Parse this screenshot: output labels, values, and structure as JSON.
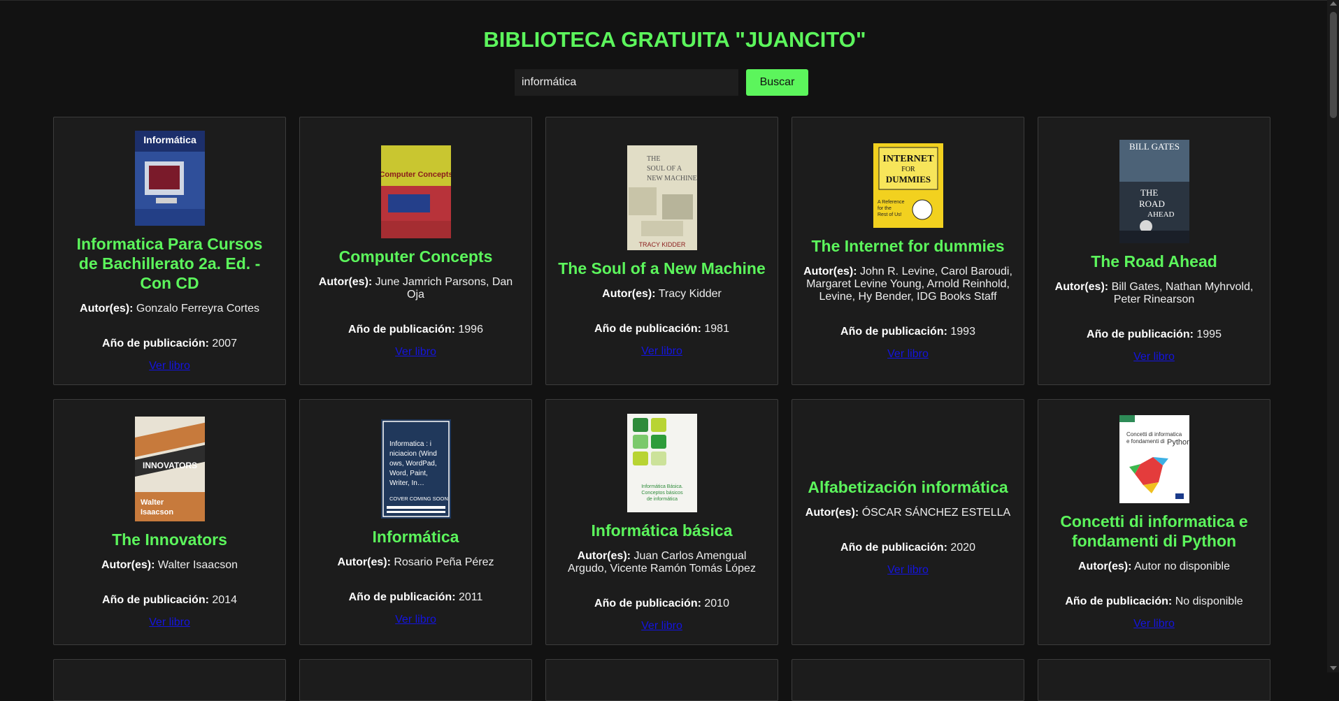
{
  "header": {
    "title": "BIBLIOTECA GRATUITA \"JUANCITO\""
  },
  "search": {
    "value": "informática",
    "button_label": "Buscar"
  },
  "labels": {
    "authors": "Autor(es):",
    "year": "Año de publicación:",
    "view_link": "Ver libro"
  },
  "colors": {
    "accent": "#5cf55c",
    "background": "#121212",
    "card": "#1c1c1c",
    "link": "#1414e0"
  },
  "books": [
    {
      "title": "Informatica Para Cursos de Bachillerato 2a. Ed. - Con CD",
      "authors": "Gonzalo Ferreyra Cortes",
      "year": "2007",
      "cover_text": "Informática",
      "cover_color": "#3a5ea8"
    },
    {
      "title": "Computer Concepts",
      "authors": "June Jamrich Parsons, Dan Oja",
      "year": "1996",
      "cover_text": "Computer Concepts",
      "cover_color": "#c8c828"
    },
    {
      "title": "The Soul of a New Machine",
      "authors": "Tracy Kidder",
      "year": "1981",
      "cover_text": "THE SOUL OF A NEW MACHINE",
      "cover_color": "#e0dcc4"
    },
    {
      "title": "The Internet for dummies",
      "authors": "John R. Levine, Carol Baroudi, Margaret Levine Young, Arnold Reinhold, Levine, Hy Bender, IDG Books Staff",
      "year": "1993",
      "cover_text": "INTERNET FOR DUMMIES",
      "cover_color": "#f3d21c"
    },
    {
      "title": "The Road Ahead",
      "authors": "Bill Gates, Nathan Myhrvold, Peter Rinearson",
      "year": "1995",
      "cover_text": "BILL GATES THE ROAD AHEAD",
      "cover_color": "#2b3442"
    },
    {
      "title": "The Innovators",
      "authors": "Walter Isaacson",
      "year": "2014",
      "cover_text": "THE INNOVATORS Walter Isaacson",
      "cover_color": "#c97a3a"
    },
    {
      "title": "Informática",
      "authors": "Rosario Peña Pérez",
      "year": "2011",
      "cover_text": "Informatica : iniciacion (Windows, WordPad, Word, Paint, Writer, In… COVER COMING SOON",
      "cover_color": "#1f3a5f"
    },
    {
      "title": "Informática básica",
      "authors": "Juan Carlos Amengual Argudo, Vicente Ramón Tomás López",
      "year": "2010",
      "cover_text": "Informática Básica. Conceptos básicos de informática",
      "cover_color": "#f4f4f0"
    },
    {
      "title": "Alfabetización informática",
      "authors": "ÓSCAR SÁNCHEZ ESTELLA",
      "year": "2020",
      "cover_text": "",
      "cover_color": ""
    },
    {
      "title": "Concetti di informatica e fondamenti di Python",
      "authors": "Autor no disponible",
      "year": "No disponible",
      "cover_text": "Concetti di informatica e fondamenti di Python",
      "cover_color": "#ffffff"
    }
  ]
}
